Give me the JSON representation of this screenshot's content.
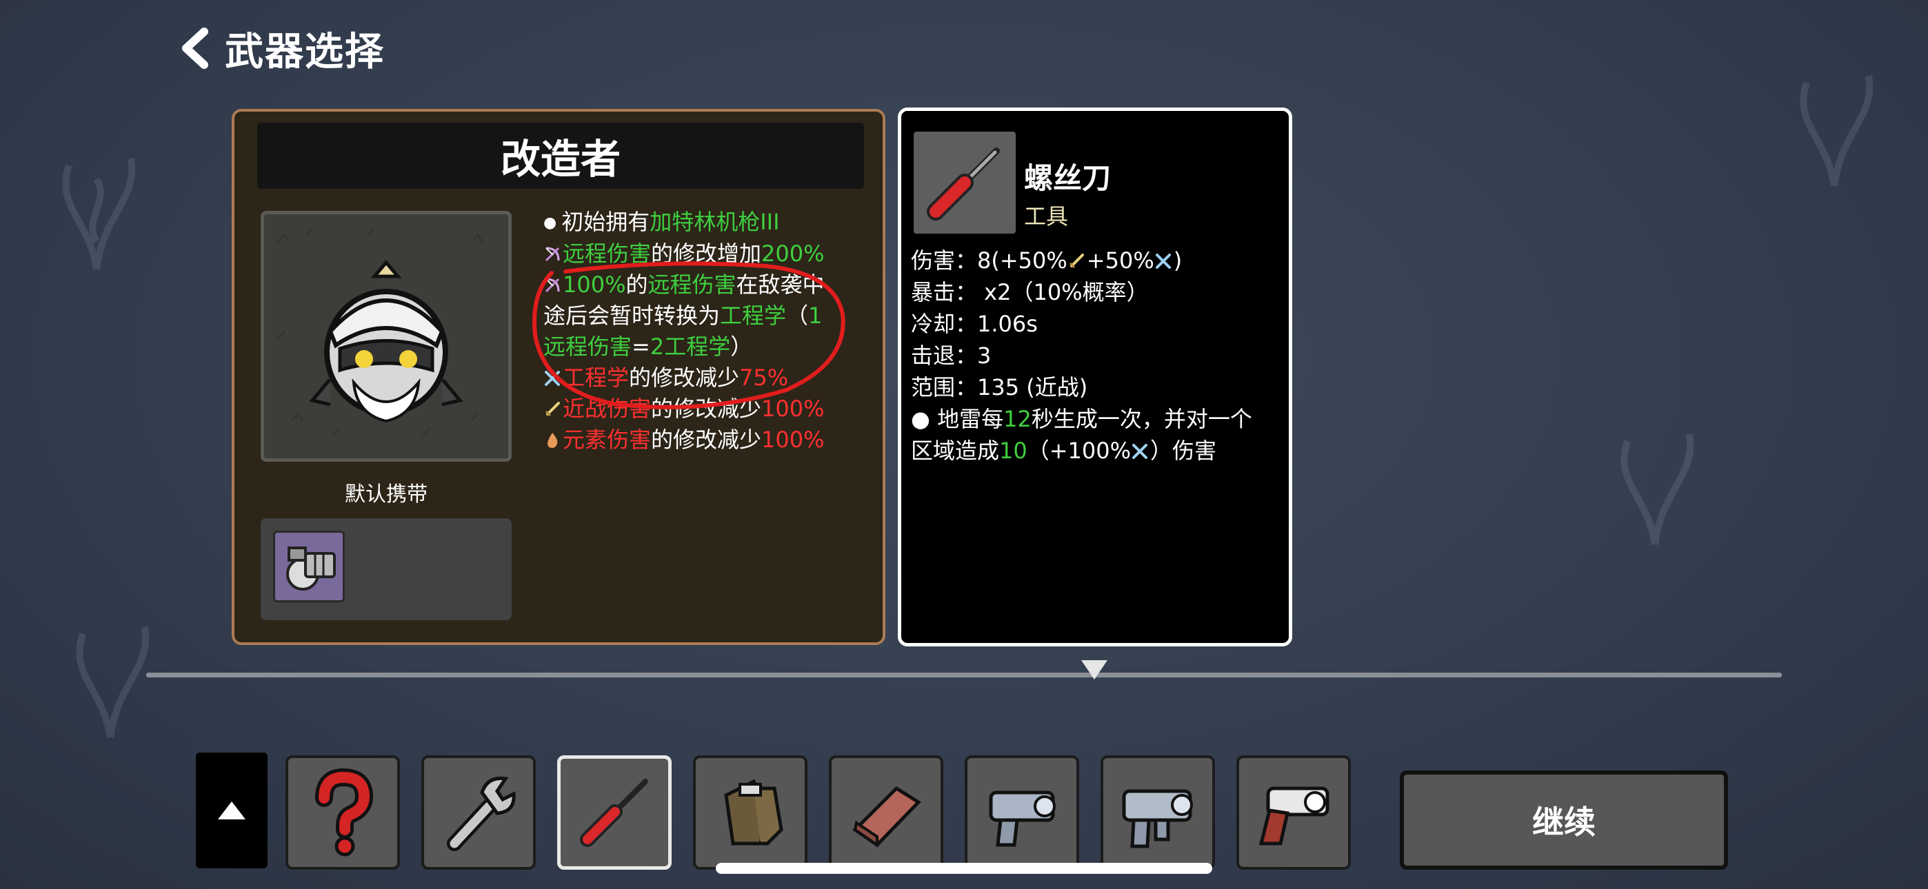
{
  "header": {
    "back_icon": "chevron-left-icon",
    "title": "武器选择"
  },
  "character": {
    "name": "改造者",
    "default_label": "默认携带",
    "description": [
      {
        "icon": "bullet",
        "parts": [
          {
            "text": "初始拥有",
            "color": "white"
          },
          {
            "text": "加特林机枪III",
            "color": "green"
          }
        ]
      },
      {
        "icon": "ranged-icon",
        "parts": [
          {
            "text": "远程伤害",
            "color": "green"
          },
          {
            "text": "的修改增加",
            "color": "white"
          },
          {
            "text": "200%",
            "color": "green"
          }
        ]
      },
      {
        "icon": "ranged-icon",
        "parts": [
          {
            "text": "100%",
            "color": "green"
          },
          {
            "text": "的",
            "color": "white"
          },
          {
            "text": "远程伤害",
            "color": "green"
          },
          {
            "text": "在敌袭中",
            "color": "white"
          }
        ]
      },
      {
        "icon": "none",
        "parts": [
          {
            "text": "途后会暂时转换为",
            "color": "white"
          },
          {
            "text": "工程学",
            "color": "green"
          },
          {
            "text": "（",
            "color": "white"
          },
          {
            "text": "1",
            "color": "green"
          }
        ]
      },
      {
        "icon": "none",
        "parts": [
          {
            "text": "远程伤害",
            "color": "green"
          },
          {
            "text": "=",
            "color": "white"
          },
          {
            "text": "2工程学",
            "color": "green"
          },
          {
            "text": "）",
            "color": "white"
          }
        ]
      },
      {
        "icon": "engineering-icon",
        "parts": [
          {
            "text": "工程学",
            "color": "red"
          },
          {
            "text": "的修改减少",
            "color": "white"
          },
          {
            "text": "75%",
            "color": "red"
          }
        ]
      },
      {
        "icon": "melee-icon",
        "parts": [
          {
            "text": "近战伤害",
            "color": "red"
          },
          {
            "text": "的修改减少",
            "color": "white"
          },
          {
            "text": "100%",
            "color": "red"
          }
        ]
      },
      {
        "icon": "elemental-icon",
        "parts": [
          {
            "text": "元素伤害",
            "color": "red"
          },
          {
            "text": "的修改减少",
            "color": "white"
          },
          {
            "text": "100%",
            "color": "red"
          }
        ]
      }
    ]
  },
  "weapon": {
    "name": "螺丝刀",
    "type": "工具",
    "stats": [
      [
        {
          "text": "伤害：8(+50%",
          "color": "white"
        },
        {
          "icon": "melee-icon"
        },
        {
          "text": "+50%",
          "color": "white"
        },
        {
          "icon": "engineering-icon"
        },
        {
          "text": ")",
          "color": "white"
        }
      ],
      [
        {
          "text": "暴击： x2（10%概率）",
          "color": "white"
        }
      ],
      [
        {
          "text": "冷却：1.06s",
          "color": "white"
        }
      ],
      [
        {
          "text": "击退：3",
          "color": "white"
        }
      ],
      [
        {
          "text": "范围：135 (近战)",
          "color": "white"
        }
      ],
      [
        {
          "text": "● 地雷每",
          "color": "white"
        },
        {
          "text": "12",
          "color": "green"
        },
        {
          "text": "秒生成一次，并对一个",
          "color": "white"
        }
      ],
      [
        {
          "text": "区域造成",
          "color": "white"
        },
        {
          "text": "10",
          "color": "green"
        },
        {
          "text": "（+100%",
          "color": "white"
        },
        {
          "icon": "engineering-icon"
        },
        {
          "text": "）伤害",
          "color": "white"
        }
      ]
    ]
  },
  "item_bar": {
    "slots": [
      {
        "icon": "question-mark-icon"
      },
      {
        "icon": "wrench-icon"
      },
      {
        "icon": "screwdriver-icon",
        "selected": true
      },
      {
        "icon": "gloves-icon"
      },
      {
        "icon": "brick-icon"
      },
      {
        "icon": "laser-pistol-icon"
      },
      {
        "icon": "laser-smg-icon"
      },
      {
        "icon": "revolver-icon"
      }
    ],
    "continue_label": "继续"
  },
  "colors": {
    "green": "#3fcf3f",
    "red": "#ff3030",
    "card_border": "#ab7b55",
    "weapon_type": "#efe6b8"
  }
}
